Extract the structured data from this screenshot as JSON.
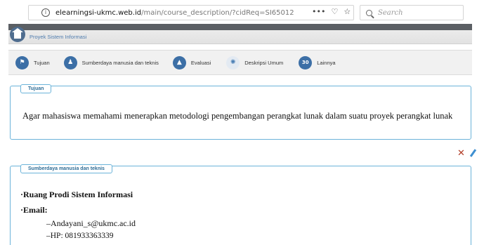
{
  "browser": {
    "url_host": "elearningsi-ukmc.web.id",
    "url_path": "/main/course_description/?cidReq=SI65012",
    "actions": [
      "•••",
      "♡",
      "☆"
    ],
    "search_placeholder": "Search"
  },
  "breadcrumb": {
    "title": "Proyek Sistem Informasi"
  },
  "tabs": [
    {
      "label": "Tujuan",
      "icon": "flag-icon",
      "glyph": "⚑"
    },
    {
      "label": "Sumberdaya manusia dan teknis",
      "icon": "people-icon",
      "glyph": "♟"
    },
    {
      "label": "Evaluasi",
      "icon": "graduation-cap-icon",
      "glyph": "▲"
    },
    {
      "label": "Deskripsi Umum",
      "icon": "atom-icon",
      "glyph": "✺"
    },
    {
      "label": "Lainnya",
      "icon": "calendar-icon",
      "glyph": "30"
    }
  ],
  "sections": {
    "tujuan": {
      "title": "Tujuan",
      "body": "Agar mahasiswa memahami menerapkan metodologi pengembangan perangkat lunak dalam suatu proyek perangkat lunak"
    },
    "sumberdaya": {
      "title": "Sumberdaya manusia dan teknis",
      "lines": [
        "·Ruang  Prodi Sistem Informasi",
        "·Email:",
        "–Andayani_s@ukmc.ac.id",
        "–HP: 081933363339"
      ]
    }
  },
  "colors": {
    "accent_border": "#6bb3d9",
    "tab_icon": "#3c6fa6",
    "delete": "#b03a24",
    "edit": "#3e8fd1"
  }
}
